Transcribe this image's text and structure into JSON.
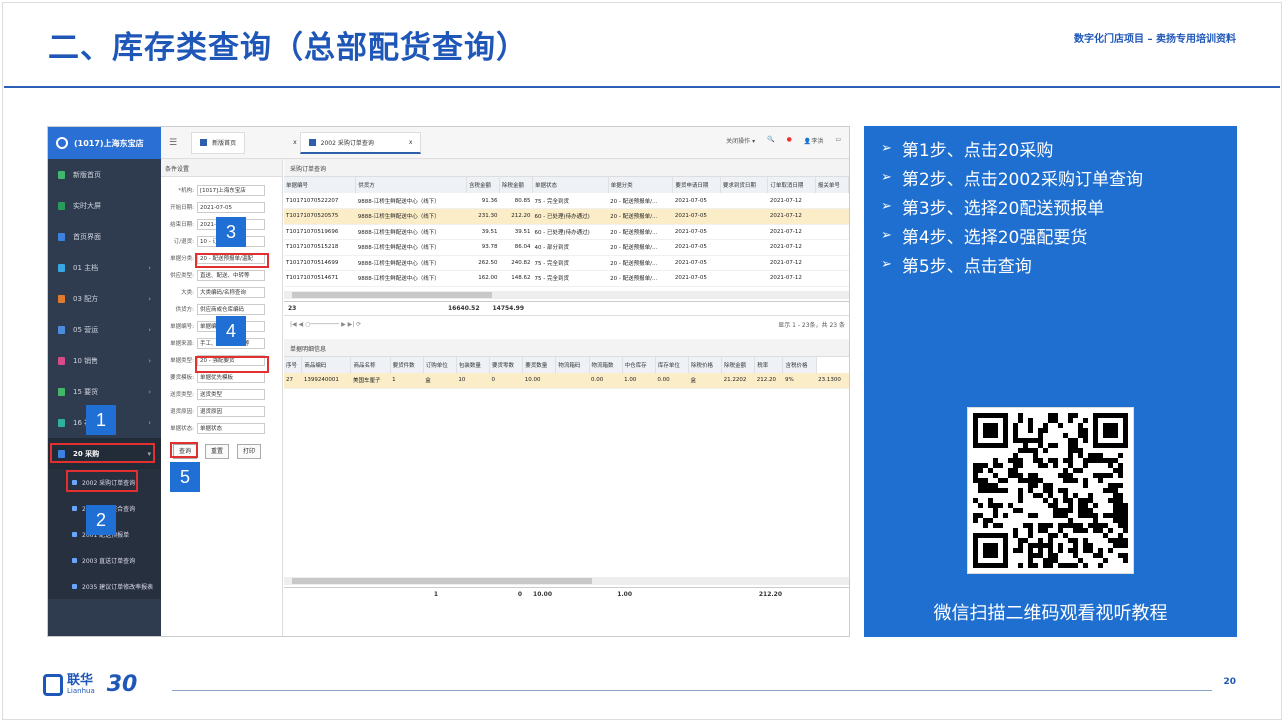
{
  "slide": {
    "title": "二、库存类查询（总部配货查询）",
    "subtitle": "数字化门店项目 – 卖扬专用培训资料",
    "page_number": "20",
    "brand_cn": "联华",
    "brand_en": "Lianhua",
    "brand_30": "30"
  },
  "sidebar": {
    "store": "(1017)上海东宝店",
    "items": [
      {
        "label": "新版首页",
        "color": "#3fb86c"
      },
      {
        "label": "实时大屏",
        "color": "#2a9c5a"
      },
      {
        "label": "首页界面",
        "color": "#3b82e0"
      },
      {
        "label": "01 主档",
        "color": "#36a7e0"
      },
      {
        "label": "03 配方",
        "color": "#e07a2e"
      },
      {
        "label": "05 营运",
        "color": "#4b8be0"
      },
      {
        "label": "10 销售",
        "color": "#d94a8a"
      },
      {
        "label": "15 要货",
        "color": "#3fb86c"
      },
      {
        "label": "16 补货",
        "color": "#2fb0a0"
      }
    ],
    "purchase": "20 采购",
    "sub_items": [
      "2002 采购订单查询",
      "2004 采购整合查询",
      "2001 配送预报单",
      "2003 直送订单查询",
      "2035 建议订单修改率报表"
    ]
  },
  "topbar": {
    "tab_home": "新版首页",
    "tab_active": "2002 采购订单查询",
    "close": "x",
    "close_ops": "关闭操作 ▾",
    "user": "李洪"
  },
  "filter": {
    "header": "条件设置",
    "rows": [
      {
        "label": "*机构:",
        "value": "[1017]上海东宝店"
      },
      {
        "label": "开始日期:",
        "value": "2021-07-05"
      },
      {
        "label": "结束日期:",
        "value": "2021-07-05"
      },
      {
        "label": "订/退货:",
        "value": "10 - 订货"
      },
      {
        "label": "单据分类:",
        "value": "20 - 配送预报单/温配"
      },
      {
        "label": "供应类型:",
        "value": "直送、配送、中转等"
      },
      {
        "label": "大类:",
        "value": "大类编码/名称查询"
      },
      {
        "label": "供货方:",
        "value": "供应商或仓库编码"
      },
      {
        "label": "单据编号:",
        "value": "单据编号"
      },
      {
        "label": "单据来源:",
        "value": "手工、自动、三方等"
      },
      {
        "label": "单据类型:",
        "value": "20 - 强配要货"
      },
      {
        "label": "要货模板:",
        "value": "单据优先模板"
      },
      {
        "label": "送货类型:",
        "value": "送货类型"
      },
      {
        "label": "退货原因:",
        "value": "退货原因"
      },
      {
        "label": "单据状态:",
        "value": "单据状态"
      }
    ],
    "query_btn": "查询",
    "reset_btn": "重置",
    "print_btn": "打印"
  },
  "orders": {
    "header": "采购订单查询",
    "columns": [
      "单据编号",
      "供货方",
      "含税金额",
      "除税金额",
      "单据状态",
      "单据分类",
      "要货申请日期",
      "要求到货日期",
      "订单取消日期",
      "报关单号"
    ],
    "rows": [
      [
        "T10171070522207",
        "9888-江桥生鲜配送中心（线下）",
        "91.36",
        "80.85",
        "75 - 完全到货",
        "20 - 配送预报单/...",
        "2021-07-05",
        "",
        "2021-07-12",
        ""
      ],
      [
        "T10171070520575",
        "9888-江桥生鲜配送中心（线下）",
        "231.30",
        "212.20",
        "60 - 已处理(待办通过)",
        "20 - 配送预报单/...",
        "2021-07-05",
        "",
        "2021-07-12",
        ""
      ],
      [
        "T10171070519696",
        "9888-江桥生鲜配送中心（线下）",
        "39.51",
        "39.51",
        "60 - 已处理(待办通过)",
        "20 - 配送预报单/...",
        "2021-07-05",
        "",
        "2021-07-12",
        ""
      ],
      [
        "T10171070515218",
        "9888-江桥生鲜配送中心（线下）",
        "93.78",
        "86.04",
        "40 - 部分到货",
        "20 - 配送预报单/...",
        "2021-07-05",
        "",
        "2021-07-12",
        ""
      ],
      [
        "T10171070514699",
        "9888-江桥生鲜配送中心（线下）",
        "262.50",
        "240.82",
        "75 - 完全到货",
        "20 - 配送预报单/...",
        "2021-07-05",
        "",
        "2021-07-12",
        ""
      ],
      [
        "T10171070514671",
        "9888-江桥生鲜配送中心（线下）",
        "162.00",
        "148.62",
        "75 - 完全到货",
        "20 - 配送预报单/...",
        "2021-07-05",
        "",
        "2021-07-12",
        ""
      ]
    ],
    "total_count": "23",
    "total_tax": "16640.52",
    "total_notax": "14754.99",
    "pager_info": "显示 1 - 23条，共 23 条"
  },
  "details": {
    "header": "单据明细信息",
    "columns": [
      "序号",
      "商品编码",
      "商品名称",
      "要货件数",
      "订购单位",
      "包装数量",
      "要货零数",
      "要货数量",
      "物流箱码",
      "物流箱数",
      "中仓库存",
      "库存单位",
      "除税价格",
      "除税金额",
      "税率",
      "含税价格"
    ],
    "row": [
      "27",
      "1399240001",
      "美国车厘子",
      "1",
      "盒",
      "10",
      "0",
      "10.00",
      "",
      "0.00",
      "1.00",
      "0.00",
      "盒",
      "21.2202",
      "212.20",
      "9%",
      "23.1300"
    ],
    "totals": {
      "pieces": "1",
      "zero": "0",
      "qty": "10.00",
      "boxes": "1.00",
      "amount": "212.20"
    }
  },
  "steps": [
    "第1步、点击20采购",
    "第2步、点击2002采购订单查询",
    "第3步、选择20配送预报单",
    "第4步、选择20强配要货",
    "第5步、点击查询"
  ],
  "qr_caption": "微信扫描二维码观看视听教程",
  "markers": [
    "1",
    "2",
    "3",
    "4",
    "5"
  ]
}
